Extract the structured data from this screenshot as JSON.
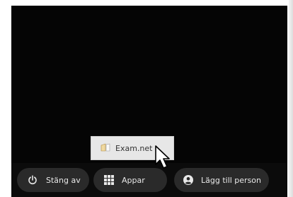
{
  "shelf": {
    "shutdown_label": "Stäng av",
    "apps_label": "Appar",
    "add_person_label": "Lägg till person"
  },
  "app_menu": {
    "item_label": "Exam.net"
  },
  "icons": {
    "shutdown": "power-icon",
    "apps": "grid-icon",
    "add_person": "person-icon",
    "exam": "exam-net-icon",
    "cursor": "mouse-pointer-icon"
  },
  "colors": {
    "screen_background": "#050505",
    "shelf_button": "#2a2a2a",
    "shelf_text": "#e8e8e8",
    "menu_background": "#e7e7e7"
  }
}
